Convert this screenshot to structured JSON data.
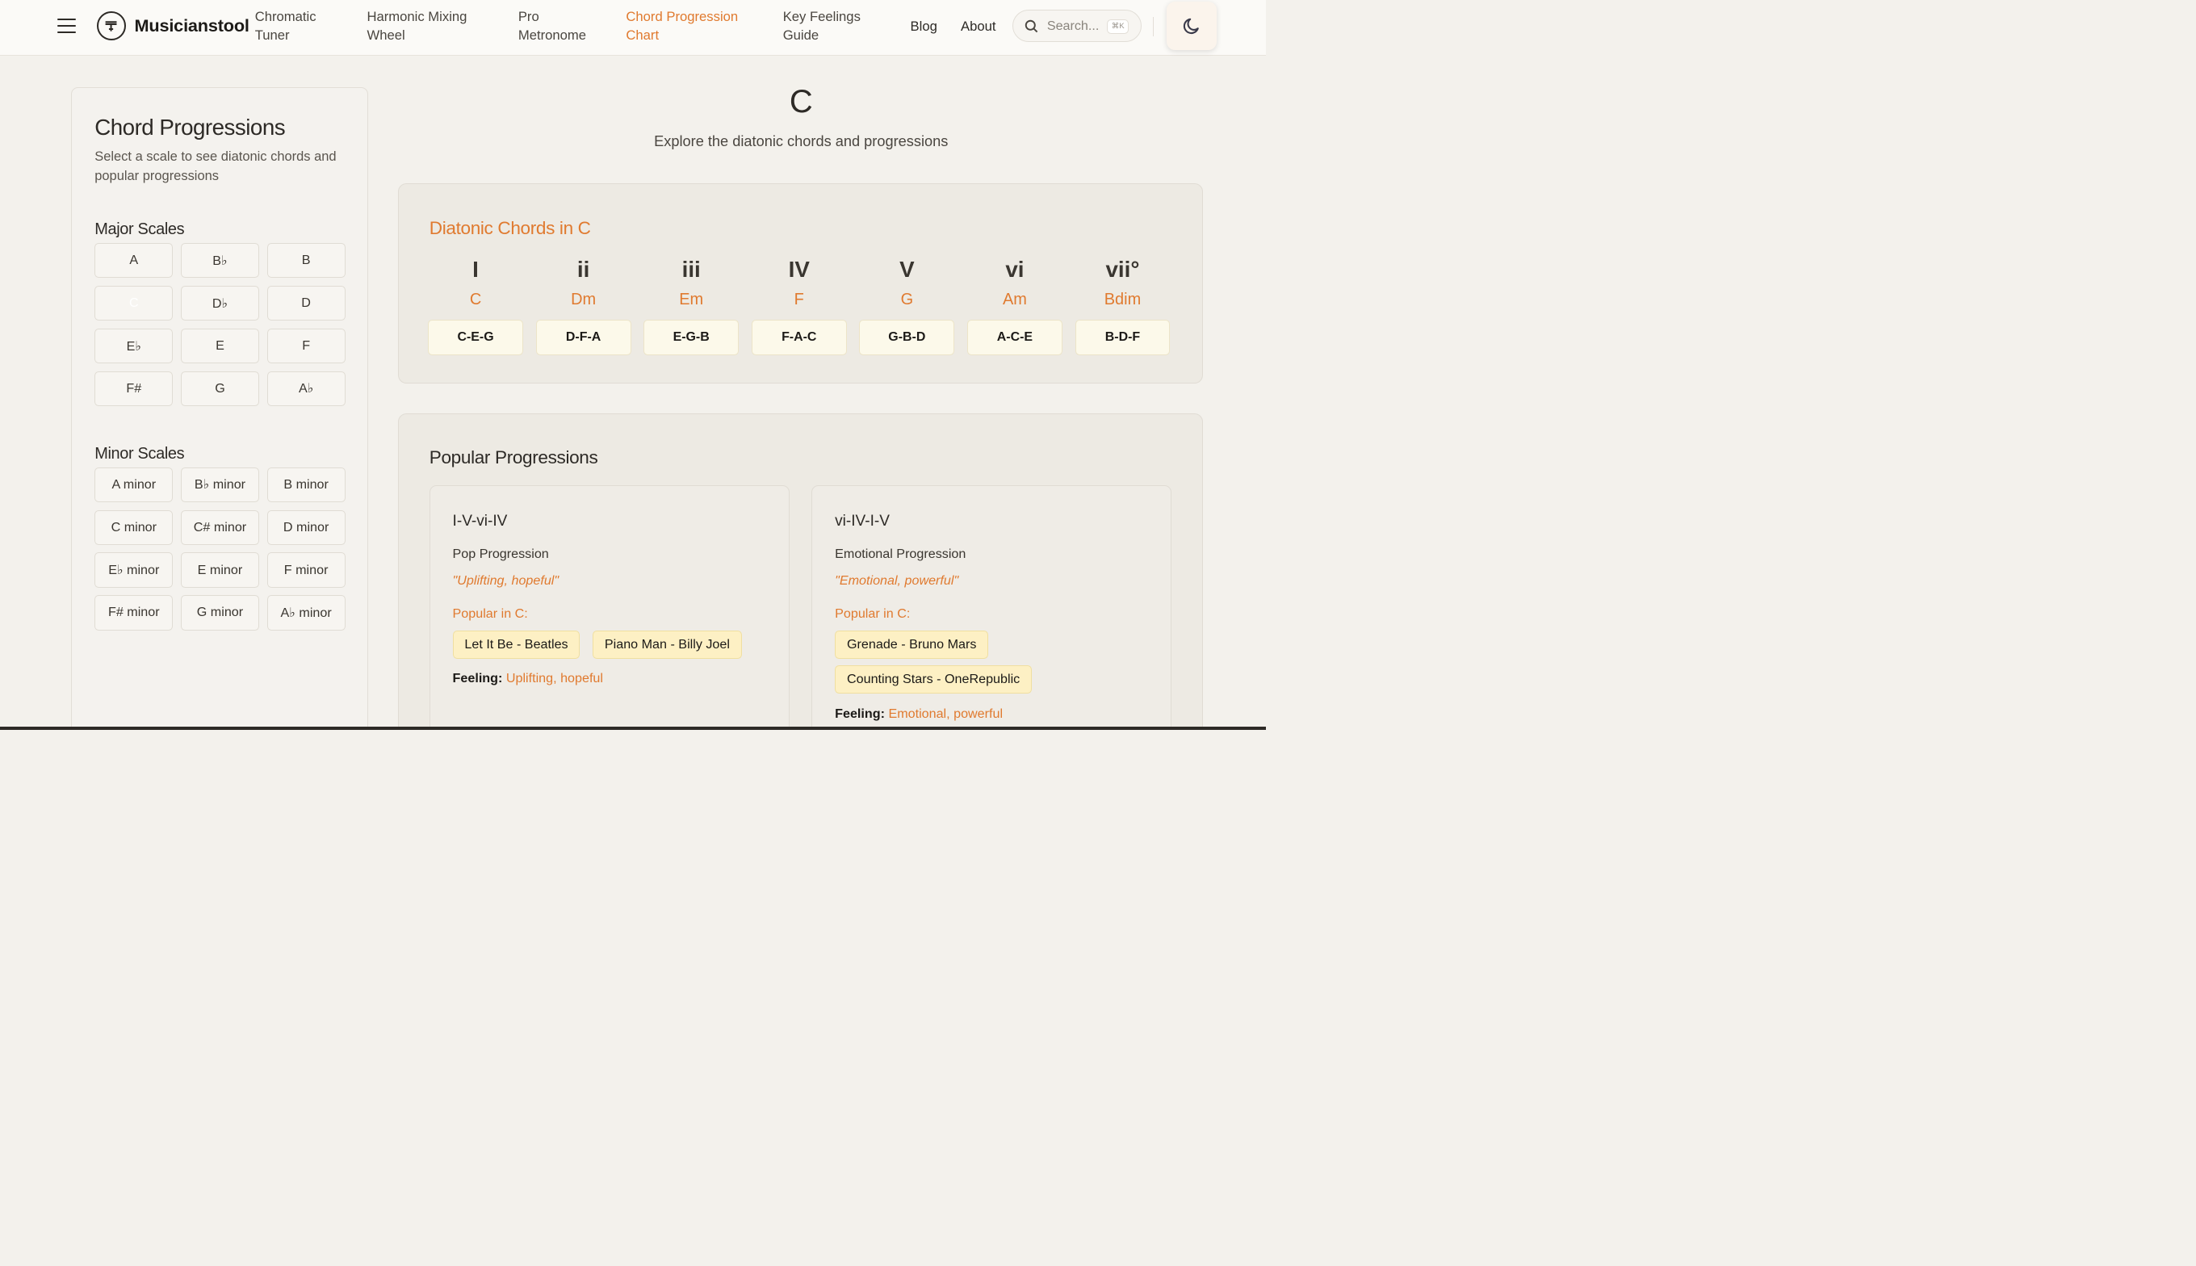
{
  "header": {
    "brand": "Musicianstool",
    "nav": [
      {
        "line1": "Chromatic",
        "line2": "Tuner"
      },
      {
        "line1": "Harmonic Mixing",
        "line2": "Wheel"
      },
      {
        "line1": "Pro",
        "line2": "Metronome"
      },
      {
        "line1": "Chord Progression",
        "line2": "Chart"
      },
      {
        "line1": "Key Feelings",
        "line2": "Guide"
      }
    ],
    "blog": "Blog",
    "about": "About",
    "search_placeholder": "Search...",
    "search_shortcut": "⌘K",
    "accent": "#e07a2f"
  },
  "sidebar": {
    "title": "Chord Progressions",
    "subtitle": "Select a scale to see diatonic chords and popular progressions",
    "major_heading": "Major Scales",
    "major": [
      "A",
      "B♭",
      "B",
      "C",
      "D♭",
      "D",
      "E♭",
      "E",
      "F",
      "F#",
      "G",
      "A♭"
    ],
    "minor_heading": "Minor Scales",
    "minor": [
      "A minor",
      "B♭ minor",
      "B minor",
      "C minor",
      "C# minor",
      "D minor",
      "E♭ minor",
      "E minor",
      "F minor",
      "F# minor",
      "G minor",
      "A♭ minor"
    ],
    "selected": "C"
  },
  "main": {
    "title": "C",
    "subtitle": "Explore the diatonic chords and progressions",
    "diatonic_heading": "Diatonic Chords in C",
    "chords": [
      {
        "roman": "I",
        "name": "C",
        "notes": "C-E-G"
      },
      {
        "roman": "ii",
        "name": "Dm",
        "notes": "D-F-A"
      },
      {
        "roman": "iii",
        "name": "Em",
        "notes": "E-G-B"
      },
      {
        "roman": "IV",
        "name": "F",
        "notes": "F-A-C"
      },
      {
        "roman": "V",
        "name": "G",
        "notes": "G-B-D"
      },
      {
        "roman": "vi",
        "name": "Am",
        "notes": "A-C-E"
      },
      {
        "roman": "vii°",
        "name": "Bdim",
        "notes": "B-D-F"
      }
    ],
    "popular_heading": "Popular Progressions",
    "progressions": [
      {
        "name": "I-V-vi-IV",
        "type": "Pop Progression",
        "quote": "\"Uplifting, hopeful\"",
        "popular_label": "Popular in C:",
        "songs": [
          "Let It Be - Beatles",
          "Piano Man - Billy Joel"
        ],
        "feeling_label": "Feeling:",
        "feeling": "Uplifting, hopeful"
      },
      {
        "name": "vi-IV-I-V",
        "type": "Emotional Progression",
        "quote": "\"Emotional, powerful\"",
        "popular_label": "Popular in C:",
        "songs": [
          "Grenade - Bruno Mars",
          "Counting Stars - OneRepublic"
        ],
        "feeling_label": "Feeling:",
        "feeling": "Emotional, powerful"
      }
    ]
  }
}
